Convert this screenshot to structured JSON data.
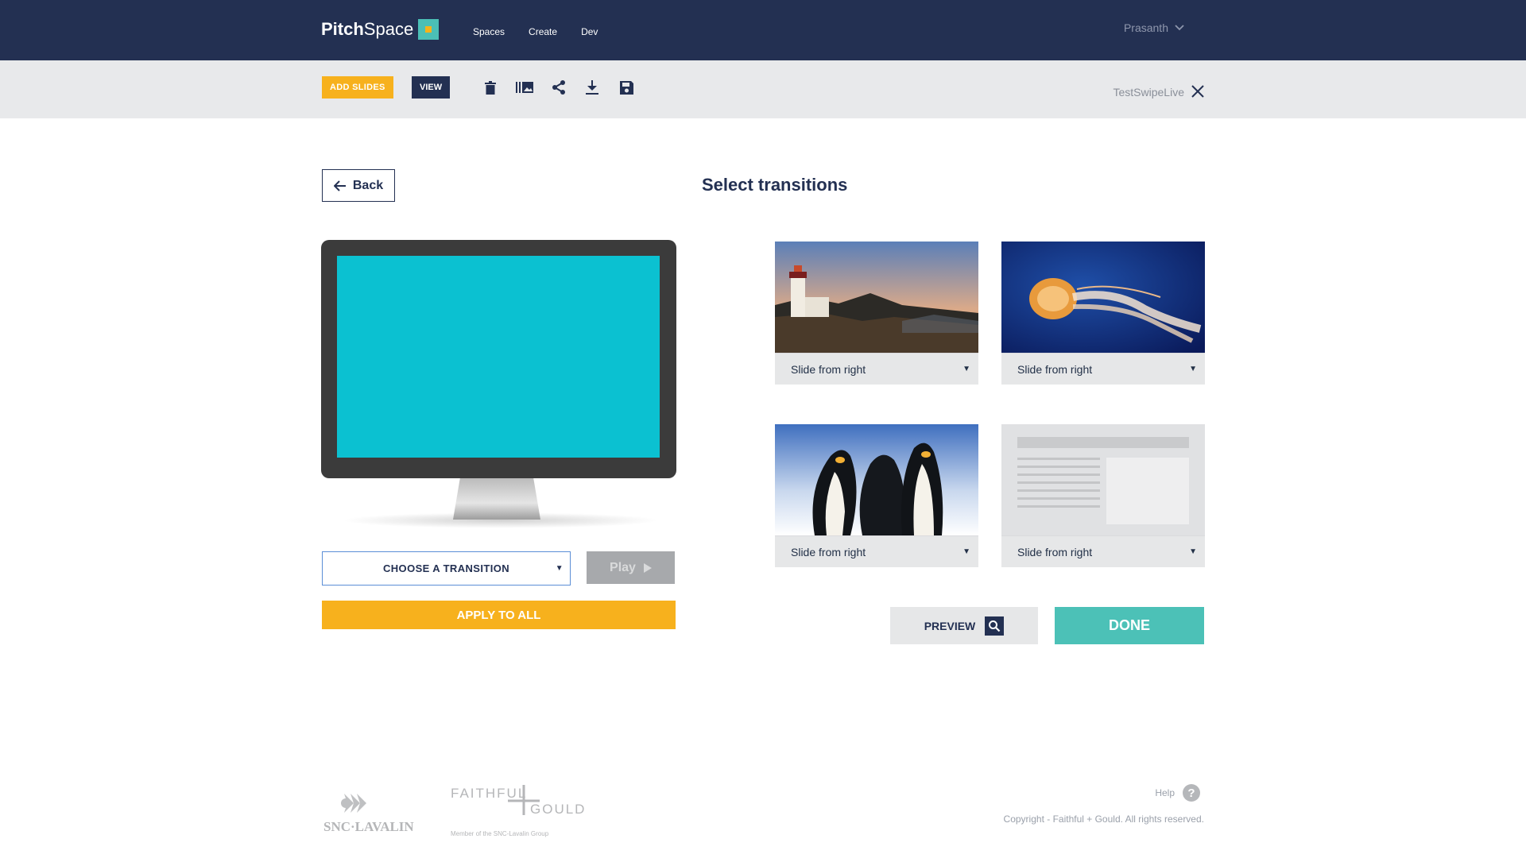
{
  "app": {
    "brand_light": "Pitch",
    "brand_bold": "Space",
    "brand_colors": {
      "navy": "#233052",
      "teal": "#4bbfb6",
      "yellow": "#f6b21b"
    }
  },
  "nav": {
    "items": [
      "Spaces",
      "Create",
      "Dev"
    ],
    "user": "Prasanth"
  },
  "toolbar": {
    "add_slides": "ADD SLIDES",
    "view": "VIEW",
    "icons": [
      "trash-icon",
      "library-icon",
      "share-icon",
      "download-icon",
      "save-icon"
    ],
    "document_name": "TestSwipeLive"
  },
  "main": {
    "back_label": "Back",
    "title": "Select transitions",
    "choose_label": "CHOOSE A TRANSITION",
    "play_label": "Play",
    "apply_label": "APPLY TO ALL",
    "slides": [
      {
        "image": "lighthouse-sunset",
        "transition": "Slide from right"
      },
      {
        "image": "jellyfish",
        "transition": "Slide from right"
      },
      {
        "image": "penguins",
        "transition": "Slide from right"
      },
      {
        "image": "text-layout-placeholder",
        "transition": "Slide from right"
      }
    ],
    "preview_label": "PREVIEW",
    "done_label": "DONE"
  },
  "footer": {
    "logo1": "SNC·LAVALIN",
    "logo2_top": "FAITHFUL",
    "logo2_bottom": "GOULD",
    "logo2_caption": "Member of the SNC-Lavalin Group",
    "help_label": "Help",
    "copyright": "Copyright - Faithful + Gould. All rights reserved."
  }
}
